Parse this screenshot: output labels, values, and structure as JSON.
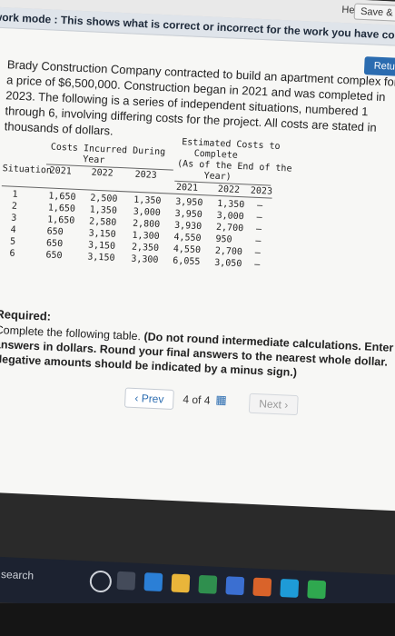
{
  "topbar": {
    "help": "Help",
    "save_exit": "Save & Exit"
  },
  "banner": {
    "text": "k my work mode : This shows what is correct or incorrect for the work you have completed so far. It does not indicate completio"
  },
  "return_button": "Return to qu",
  "intro": "Brady Construction Company contracted to build an apartment complex for a price of $6,500,000. Construction began in 2021 and was completed in 2023. The following is a series of independent situations, numbered 1 through 6, involving differing costs for the project. All costs are stated in thousands of dollars.",
  "table": {
    "group1": "Costs Incurred During",
    "group1_sub": "Year",
    "group2_line1": "Estimated Costs to",
    "group2_line2": "Complete",
    "group2_line3": "(As of the End of the",
    "group2_line4": "Year)",
    "col_situation": "Situation",
    "cols": [
      "2021",
      "2022",
      "2023",
      "2021",
      "2022",
      "2023"
    ],
    "rows": [
      [
        "1",
        "1,650",
        "2,500",
        "1,350",
        "3,950",
        "1,350",
        "–"
      ],
      [
        "2",
        "1,650",
        "1,350",
        "3,000",
        "3,950",
        "3,000",
        "–"
      ],
      [
        "3",
        "1,650",
        "2,580",
        "2,800",
        "3,930",
        "2,700",
        "–"
      ],
      [
        "4",
        "650",
        "3,150",
        "1,300",
        "4,550",
        "950",
        "–"
      ],
      [
        "5",
        "650",
        "3,150",
        "2,350",
        "4,550",
        "2,700",
        "–"
      ],
      [
        "6",
        "650",
        "3,150",
        "3,300",
        "6,055",
        "3,050",
        "–"
      ]
    ]
  },
  "required": {
    "label": "Required:",
    "text_plain": "Complete the following table.",
    "text_bold": "(Do not round intermediate calculations. Enter answers in dollars. Round your final answers to the nearest whole dollar. Negative amounts should be indicated by a minus sign.)"
  },
  "pager": {
    "prev": "Prev",
    "current": "4",
    "of": "of",
    "total": "4",
    "next": "Next"
  },
  "taskbar": {
    "search": "search"
  }
}
